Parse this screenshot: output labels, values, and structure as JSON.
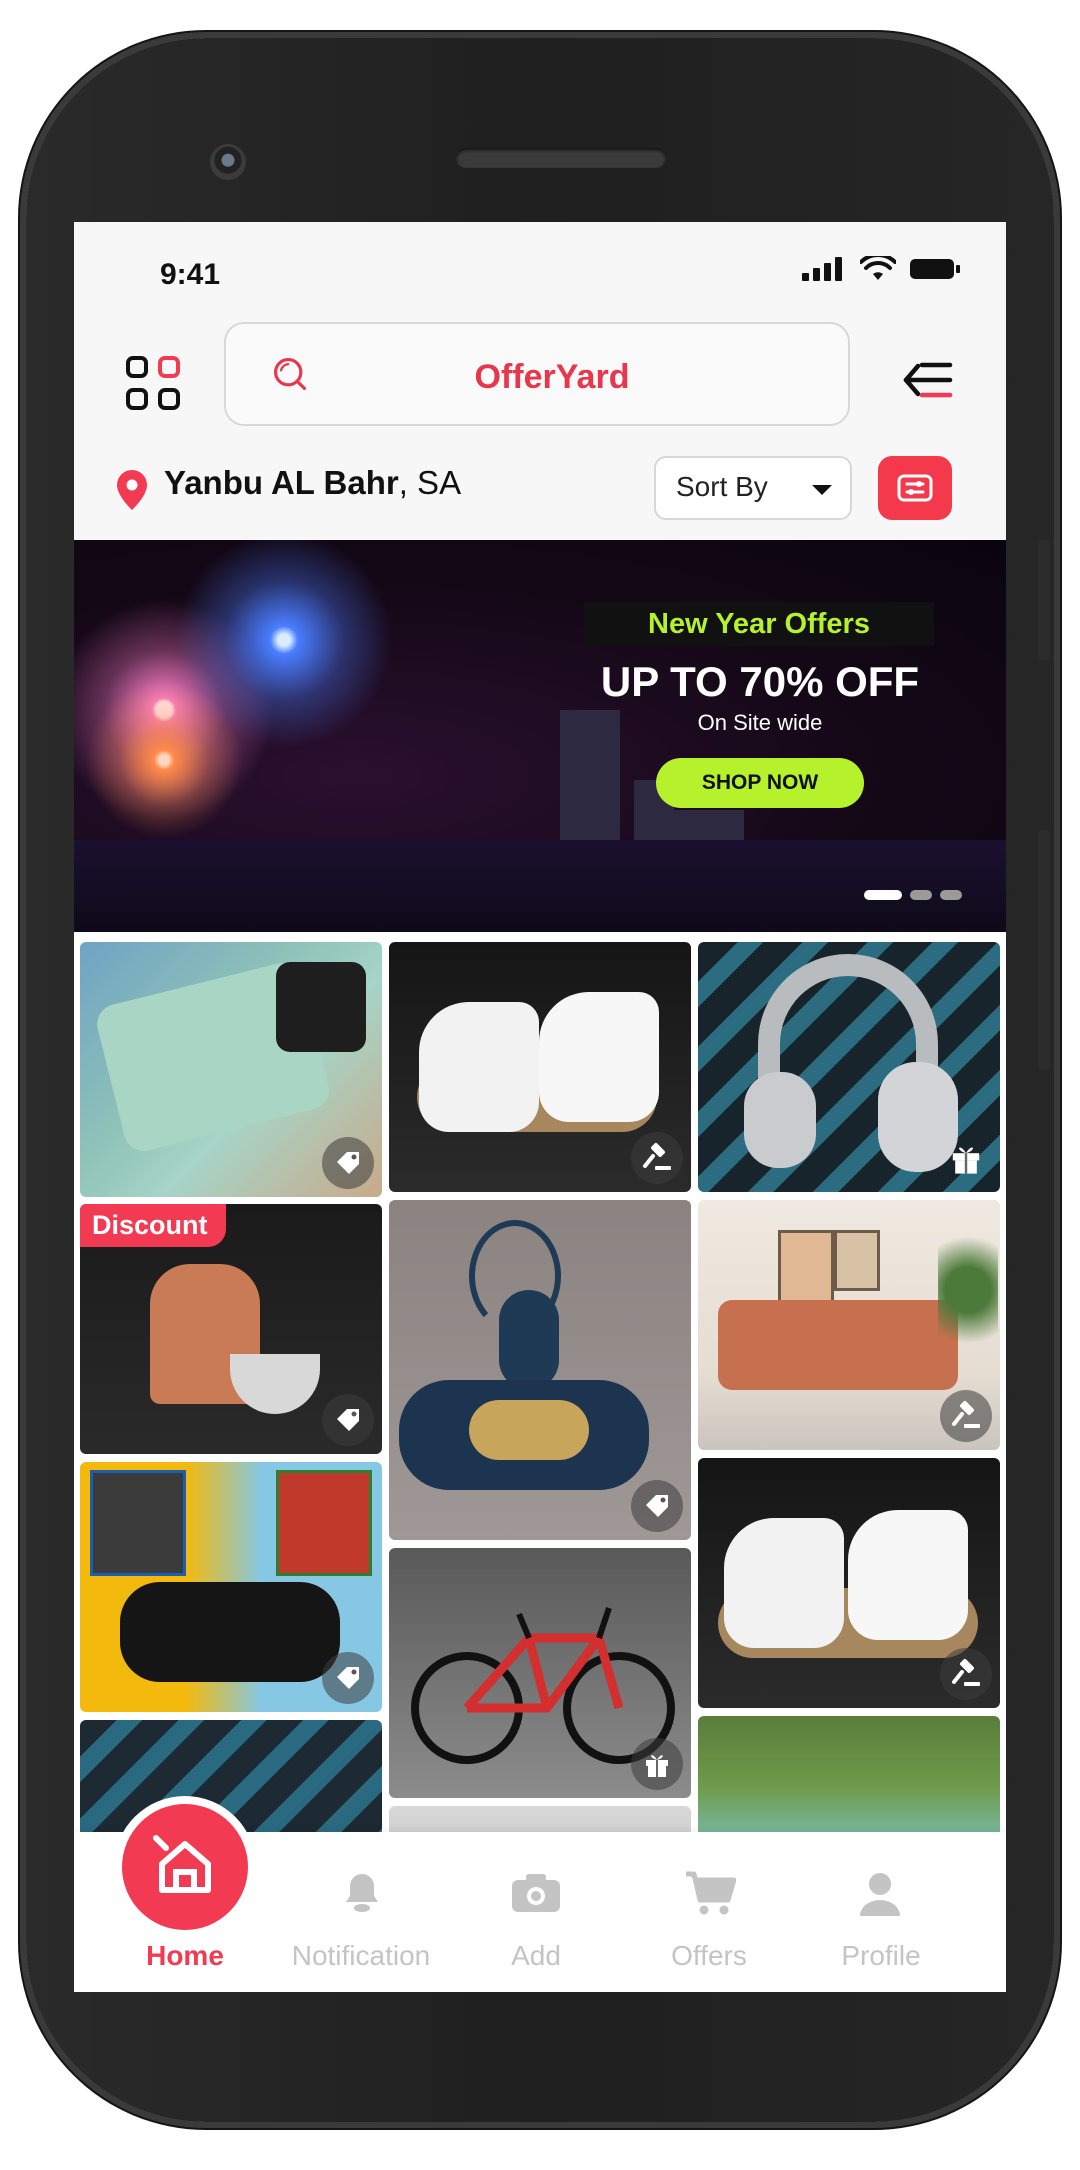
{
  "status_bar": {
    "time": "9:41"
  },
  "header": {
    "logo_text": "OfferYard",
    "menu_icon": "grid-icon",
    "search_icon": "search-icon",
    "filter_icon": "filter-icon"
  },
  "location": {
    "city": "Yanbu AL Bahr",
    "country": ", SA"
  },
  "sort": {
    "label": "Sort By"
  },
  "banner": {
    "tag": "New Year Offers",
    "headline": "UP TO 70% OFF",
    "subline": "On Site wide",
    "cta": "SHOP NOW",
    "active_slide": 1,
    "slide_count": 3
  },
  "tiles": [
    {
      "name": "tile-phone",
      "badge_icon": "tag-icon"
    },
    {
      "name": "tile-sneakers",
      "badge_icon": "gavel-icon"
    },
    {
      "name": "tile-headphones",
      "badge_icon": "gift-icon"
    },
    {
      "name": "tile-mixer",
      "label": "Discount",
      "badge_icon": "tag-icon"
    },
    {
      "name": "tile-deer",
      "badge_icon": "tag-icon"
    },
    {
      "name": "tile-sofa",
      "badge_icon": "gavel-icon"
    },
    {
      "name": "tile-gamepad",
      "badge_icon": "tag-icon"
    },
    {
      "name": "tile-bicycle",
      "badge_icon": "gift-icon"
    },
    {
      "name": "tile-sneakers-2",
      "badge_icon": "gavel-icon"
    }
  ],
  "tabs": [
    {
      "label": "Home",
      "active": true
    },
    {
      "label": "Notification",
      "active": false
    },
    {
      "label": "Add",
      "active": false
    },
    {
      "label": "Offers",
      "active": false
    },
    {
      "label": "Profile",
      "active": false
    }
  ],
  "colors": {
    "accent": "#f23b52",
    "lime": "#b5f22c",
    "inactive": "#c4c4c4"
  }
}
